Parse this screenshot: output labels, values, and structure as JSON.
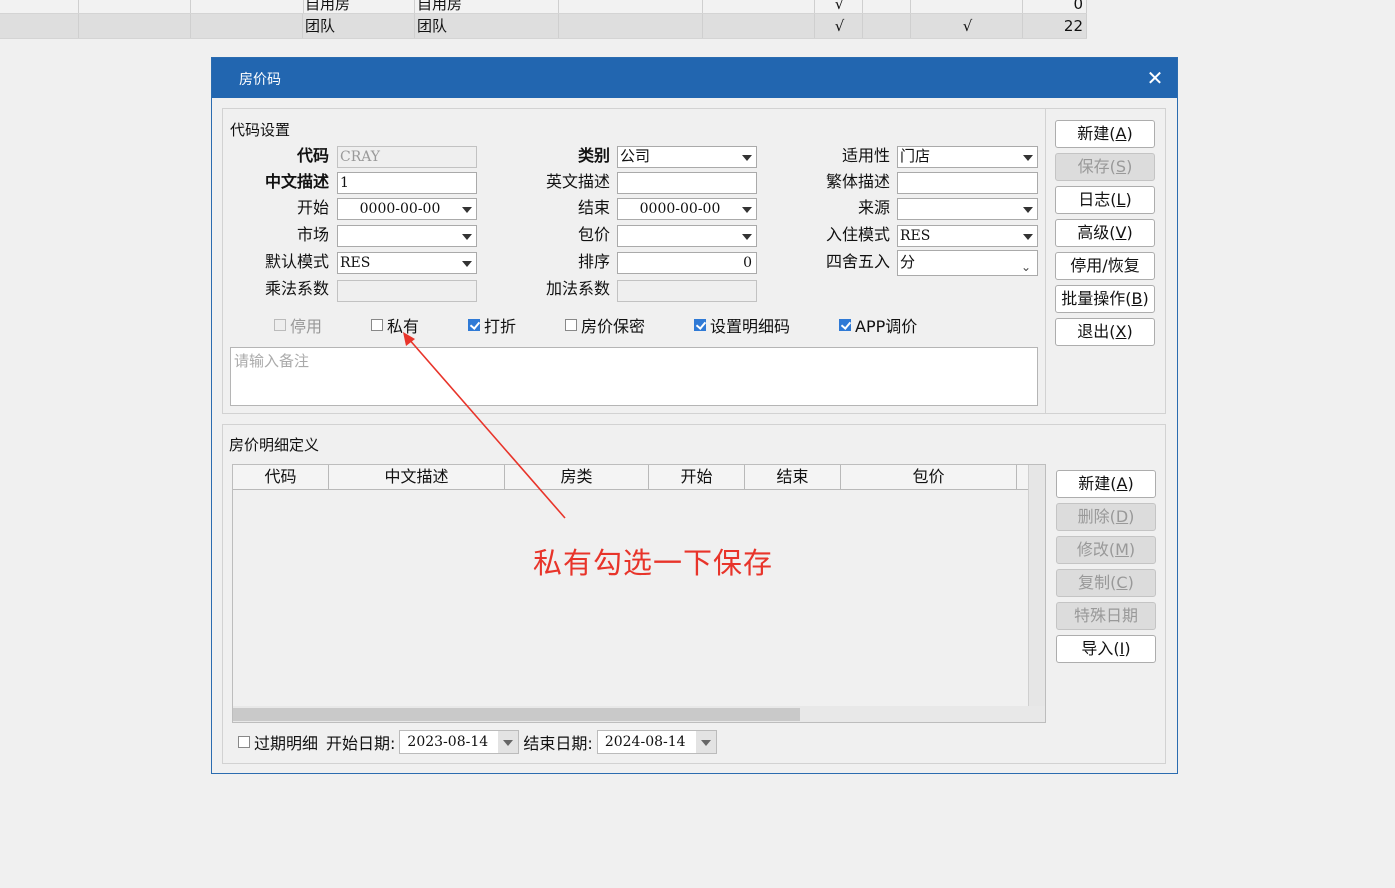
{
  "background_table": {
    "rows": [
      {
        "col_a": "自用房",
        "col_b": "自用房",
        "check1": "√",
        "check2": "",
        "num": "0"
      },
      {
        "col_a": "团队",
        "col_b": "团队",
        "check1": "√",
        "check2": "√",
        "num": "22"
      }
    ]
  },
  "dialog": {
    "title": "房价码",
    "close_glyph": "✕"
  },
  "code_settings": {
    "group_title": "代码设置",
    "code": {
      "label": "代码",
      "value": "CRAY"
    },
    "category": {
      "label": "类别",
      "value": "公司"
    },
    "applicability": {
      "label": "适用性",
      "value": "门店"
    },
    "cn_desc": {
      "label": "中文描述",
      "value": "1"
    },
    "en_desc": {
      "label": "英文描述",
      "value": ""
    },
    "tw_desc": {
      "label": "繁体描述",
      "value": ""
    },
    "start": {
      "label": "开始",
      "value": "0000-00-00"
    },
    "end": {
      "label": "结束",
      "value": "0000-00-00"
    },
    "source": {
      "label": "来源",
      "value": ""
    },
    "market": {
      "label": "市场",
      "value": ""
    },
    "package": {
      "label": "包价",
      "value": ""
    },
    "checkin_mode": {
      "label": "入住模式",
      "value": "RES"
    },
    "default_mode": {
      "label": "默认模式",
      "value": "RES"
    },
    "sort": {
      "label": "排序",
      "value": "0"
    },
    "rounding": {
      "label": "四舍五入",
      "value": "分"
    },
    "multiplier": {
      "label": "乘法系数",
      "value": ""
    },
    "adder": {
      "label": "加法系数",
      "value": ""
    },
    "checkboxes": {
      "disabled": {
        "label": "停用",
        "checked": false
      },
      "private": {
        "label": "私有",
        "checked": false
      },
      "discount": {
        "label": "打折",
        "checked": true
      },
      "rate_secret": {
        "label": "房价保密",
        "checked": false
      },
      "detail_code": {
        "label": "设置明细码",
        "checked": true
      },
      "app_adjust": {
        "label": "APP调价",
        "checked": true
      }
    },
    "remarks_placeholder": "请输入备注"
  },
  "side_buttons": {
    "new": {
      "text": "新建(",
      "key": "A",
      "end": ")"
    },
    "save": {
      "text": "保存(",
      "key": "S",
      "end": ")"
    },
    "log": {
      "text": "日志(",
      "key": "L",
      "end": ")"
    },
    "advanced": {
      "text": "高级(",
      "key": "V",
      "end": ")"
    },
    "toggle": {
      "text": "停用/恢复"
    },
    "batch": {
      "text": "批量操作(",
      "key": "B",
      "end": ")"
    },
    "exit": {
      "text": "退出(",
      "key": "X",
      "end": ")"
    }
  },
  "detail": {
    "group_title": "房价明细定义",
    "columns": [
      "代码",
      "中文描述",
      "房类",
      "开始",
      "结束",
      "包价"
    ],
    "buttons": {
      "new": {
        "text": "新建(",
        "key": "A",
        "end": ")"
      },
      "delete": {
        "text": "删除(",
        "key": "D",
        "end": ")"
      },
      "modify": {
        "text": "修改(",
        "key": "M",
        "end": ")"
      },
      "copy": {
        "text": "复制(",
        "key": "C",
        "end": ")"
      },
      "special": {
        "text": "特殊日期"
      },
      "import": {
        "text": "导入(",
        "key": "I",
        "end": ")"
      }
    },
    "expired_label": "过期明细",
    "start_date_label": "开始日期:",
    "start_date": "2023-08-14",
    "end_date_label": "结束日期:",
    "end_date": "2024-08-14"
  },
  "annotation": {
    "text": "私有勾选一下保存",
    "color": "#e8342a"
  }
}
